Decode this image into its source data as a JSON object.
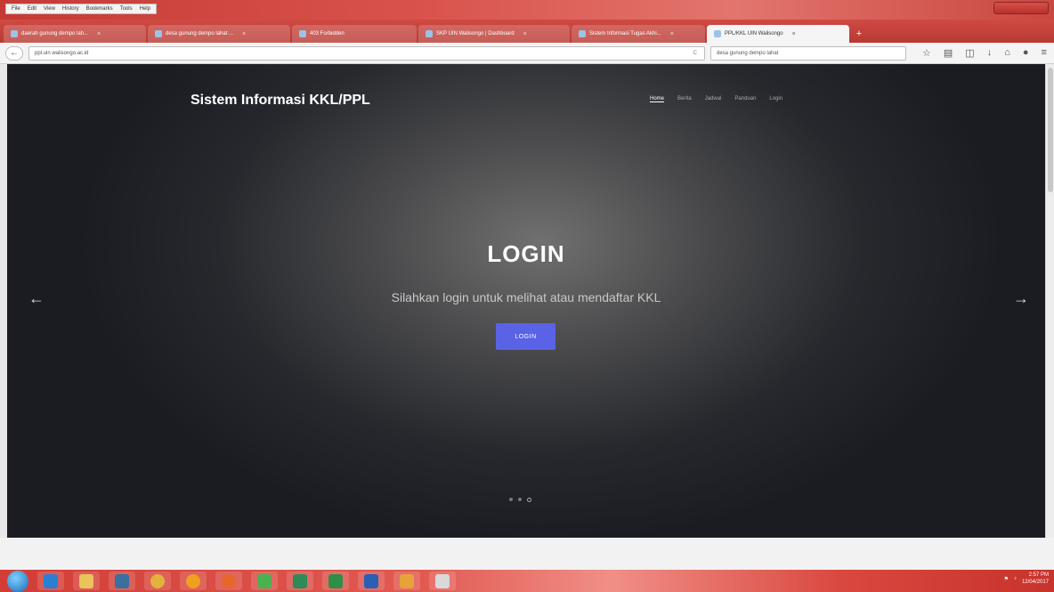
{
  "browser": {
    "menu": [
      "File",
      "Edit",
      "View",
      "History",
      "Bookmarks",
      "Tools",
      "Help"
    ],
    "tabs": [
      {
        "label": "daerah gunung dempo lah...",
        "icon": "google-icon",
        "active": false
      },
      {
        "label": "desa gunung dempo lahat ...",
        "icon": "google-icon",
        "active": false
      },
      {
        "label": "403 Forbidden",
        "icon": "page-icon",
        "active": false
      },
      {
        "label": "SKP UIN Walisongo | Dashboard",
        "icon": "page-icon",
        "active": false
      },
      {
        "label": "Sistem Informasi Tugas Akhi...",
        "icon": "page-icon",
        "active": false
      },
      {
        "label": "PPL/KKL UIN Walisongo",
        "icon": "page-icon",
        "active": true
      }
    ],
    "url": "ppl.uin walisongo.ac.id",
    "search_value": "desa gunung dempo lahat",
    "new_tab_glyph": "+",
    "back_glyph": "←",
    "reload_glyph": "C",
    "toolbar_icons": [
      "star-icon",
      "home-icon",
      "pocket-icon",
      "download-icon",
      "home-icon",
      "menu-icon"
    ]
  },
  "page": {
    "brand": "Sistem Informasi KKL/PPL",
    "nav": [
      {
        "label": "Home",
        "active": true
      },
      {
        "label": "Berita",
        "active": false
      },
      {
        "label": "Jadwal",
        "active": false
      },
      {
        "label": "Panduan",
        "active": false
      },
      {
        "label": "Login",
        "active": false
      }
    ],
    "hero": {
      "title": "LOGIN",
      "subtitle": "Silahkan login untuk melihat atau mendaftar KKL",
      "button": "LOGIN",
      "prev_glyph": "←",
      "next_glyph": "→",
      "slide_count": 3,
      "active_slide": 3
    },
    "accent_color": "#5a63e6"
  },
  "taskbar": {
    "apps": [
      "ie-icon",
      "explorer-icon",
      "media-icon",
      "chrome-icon",
      "chrome-icon",
      "firefox-icon",
      "app-icon",
      "network-icon",
      "excel-icon",
      "word-icon",
      "app-icon",
      "app-icon"
    ],
    "clock_time": "2:57 PM",
    "clock_date": "12/04/2017"
  }
}
